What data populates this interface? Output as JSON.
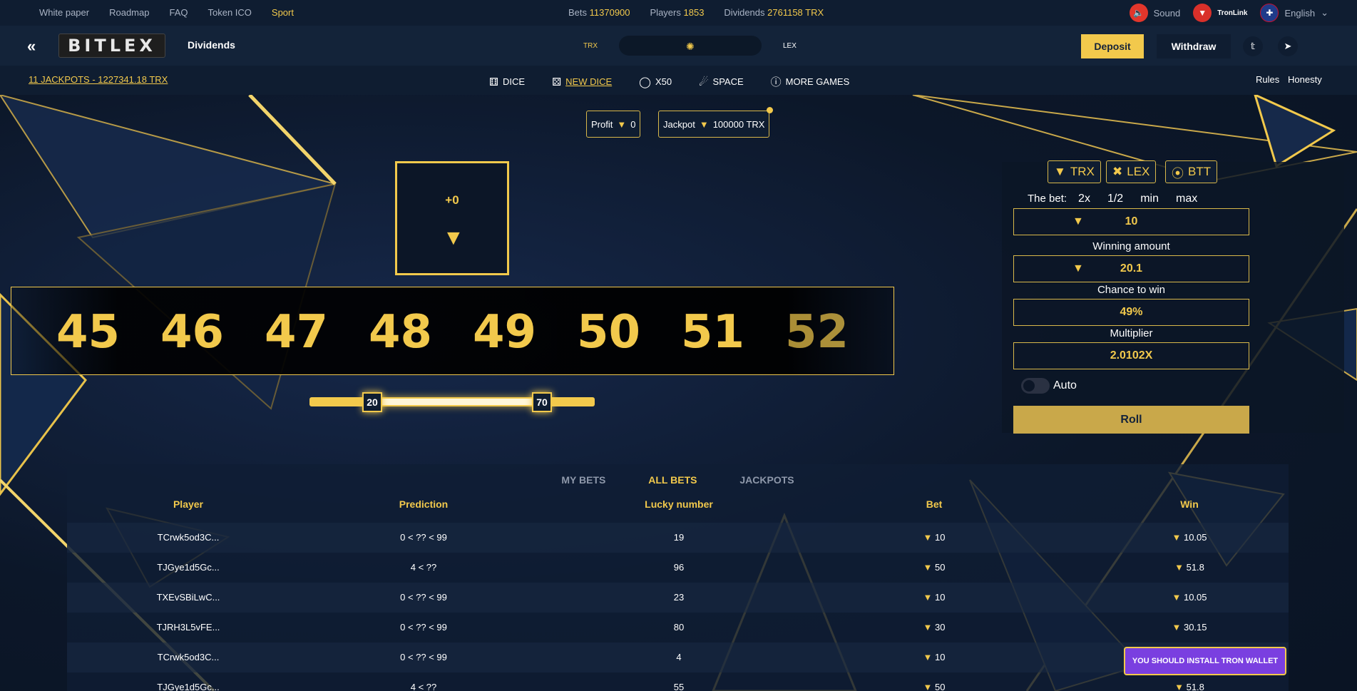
{
  "topbar": {
    "links": [
      "White paper",
      "Roadmap",
      "FAQ",
      "Token ICO",
      "Sport"
    ],
    "active_link": "Sport",
    "stats": [
      {
        "label": "Bets",
        "value": "11370900"
      },
      {
        "label": "Players",
        "value": "1853"
      },
      {
        "label": "Dividends",
        "value": "2761158 TRX"
      }
    ],
    "sound_label": "Sound",
    "wallet_label": "TronLink",
    "language": "English"
  },
  "header": {
    "logo": "BITLEX",
    "dividends_label": "Dividends",
    "currency_left": "TRX",
    "currency_right": "LEX",
    "deposit_label": "Deposit",
    "withdraw_label": "Withdraw"
  },
  "nav": {
    "jackpots_link": "11 JACKPOTS - 1227341.18 TRX",
    "games": [
      {
        "label": "DICE",
        "icon": "dice-icon"
      },
      {
        "label": "NEW DICE",
        "icon": "dice-icon"
      },
      {
        "label": "X50",
        "icon": "circle-icon"
      },
      {
        "label": "SPACE",
        "icon": "rocket-icon"
      },
      {
        "label": "MORE GAMES",
        "icon": "question-icon"
      }
    ],
    "active_game": "NEW DICE",
    "rules_label": "Rules",
    "honesty_label": "Honesty"
  },
  "stats_pills": {
    "profit_label": "Profit",
    "profit_value": "0",
    "jackpot_label": "Jackpot",
    "jackpot_value": "100000 TRX"
  },
  "result": {
    "delta": "+0"
  },
  "strip_numbers": [
    "45",
    "46",
    "47",
    "48",
    "49",
    "50",
    "51",
    "52"
  ],
  "slider": {
    "low": "20",
    "high": "70"
  },
  "panel": {
    "currencies": [
      "TRX",
      "LEX",
      "BTT"
    ],
    "bet_label": "The bet:",
    "bet_modifiers": [
      "2x",
      "1/2",
      "min",
      "max"
    ],
    "bet_value": "10",
    "winning_label": "Winning amount",
    "winning_value": "20.1",
    "chance_label": "Chance to win",
    "chance_value": "49%",
    "multiplier_label": "Multiplier",
    "multiplier_value": "2.0102X",
    "auto_label": "Auto",
    "roll_label": "Roll"
  },
  "bets": {
    "tabs": [
      "MY BETS",
      "ALL BETS",
      "JACKPOTS"
    ],
    "active_tab": "ALL BETS",
    "columns": [
      "Player",
      "Prediction",
      "Lucky number",
      "Bet",
      "Win"
    ],
    "rows": [
      {
        "player": "TCrwk5od3C...",
        "prediction": "0 < ?? < 99",
        "lucky": "19",
        "bet": "10",
        "win": "10.05"
      },
      {
        "player": "TJGye1d5Gc...",
        "prediction": "4 < ??",
        "lucky": "96",
        "bet": "50",
        "win": "51.8"
      },
      {
        "player": "TXEvSBiLwC...",
        "prediction": "0 < ?? < 99",
        "lucky": "23",
        "bet": "10",
        "win": "10.05"
      },
      {
        "player": "TJRH3L5vFE...",
        "prediction": "0 < ?? < 99",
        "lucky": "80",
        "bet": "30",
        "win": "30.15"
      },
      {
        "player": "TCrwk5od3C...",
        "prediction": "0 < ?? < 99",
        "lucky": "4",
        "bet": "10",
        "win": ""
      },
      {
        "player": "TJGye1d5Gc...",
        "prediction": "4 < ??",
        "lucky": "55",
        "bet": "50",
        "win": "51.8"
      }
    ]
  },
  "toast": "YOU SHOULD INSTALL TRON WALLET",
  "colors": {
    "accent": "#f2c94c",
    "background": "#0d1a2e",
    "toast": "#7a3fe0"
  }
}
